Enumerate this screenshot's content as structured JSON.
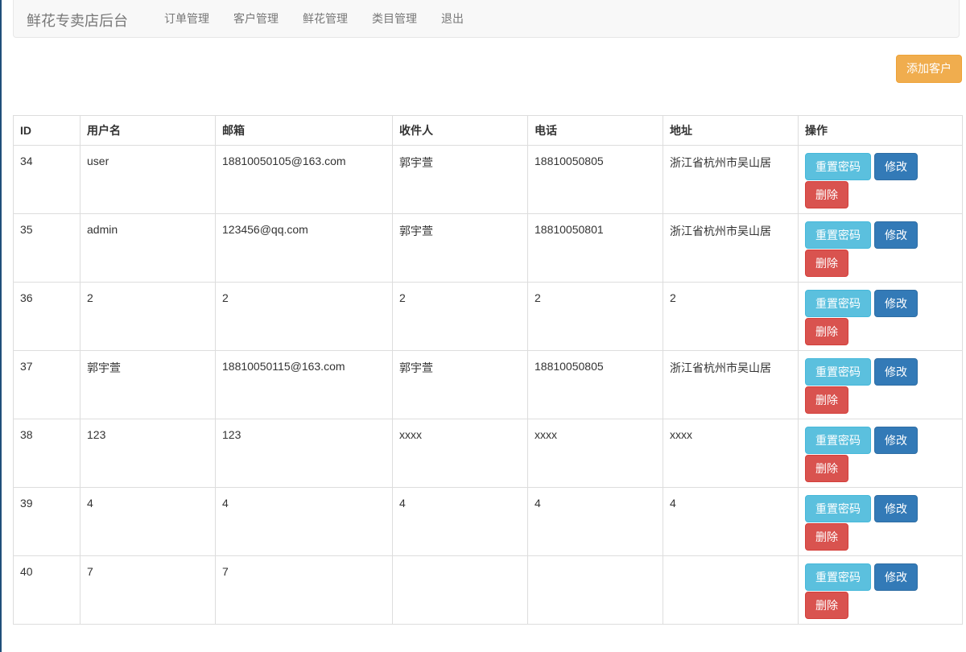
{
  "navbar": {
    "brand": "鲜花专卖店后台",
    "links": [
      "订单管理",
      "客户管理",
      "鲜花管理",
      "类目管理",
      "退出"
    ]
  },
  "toolbar": {
    "add_label": "添加客户"
  },
  "table": {
    "headers": [
      "ID",
      "用户名",
      "邮箱",
      "收件人",
      "电话",
      "地址",
      "操作"
    ],
    "rows": [
      [
        "34",
        "user",
        "18810050105@163.com",
        "郭宇萱",
        "18810050805",
        "浙江省杭州市吴山居"
      ],
      [
        "35",
        "admin",
        "123456@qq.com",
        "郭宇萱",
        "18810050801",
        "浙江省杭州市吴山居"
      ],
      [
        "36",
        "2",
        "2",
        "2",
        "2",
        "2"
      ],
      [
        "37",
        "郭宇萱",
        "18810050115@163.com",
        "郭宇萱",
        "18810050805",
        "浙江省杭州市吴山居"
      ],
      [
        "38",
        "123",
        "123",
        "xxxx",
        "xxxx",
        "xxxx"
      ],
      [
        "39",
        "4",
        "4",
        "4",
        "4",
        "4"
      ],
      [
        "40",
        "7",
        "7",
        "",
        "",
        ""
      ]
    ],
    "actions": {
      "reset": "重置密码",
      "edit": "修改",
      "delete": "删除"
    }
  },
  "colors": {
    "navbar_bg": "#f8f8f8",
    "add_button": "#f0ad4e",
    "reset_button": "#5bc0de",
    "edit_button": "#337ab7",
    "delete_button": "#d9534f"
  }
}
